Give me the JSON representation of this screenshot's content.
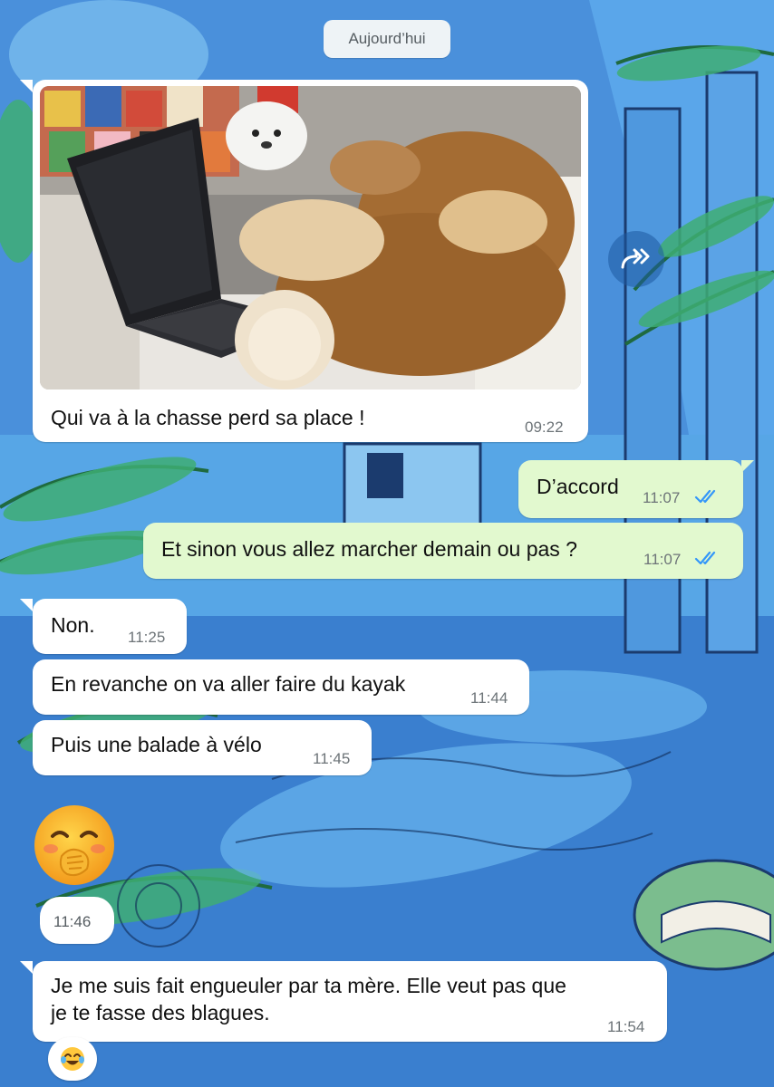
{
  "chat": {
    "date_label": "Aujourd’hui",
    "messages": [
      {
        "direction": "in",
        "type": "image",
        "caption": "Qui va à la chasse perd sa place !",
        "time": "09:22"
      },
      {
        "direction": "out",
        "text": "D’accord",
        "time": "11:07",
        "status": "read"
      },
      {
        "direction": "out",
        "text": "Et sinon vous allez marcher demain ou pas ?",
        "time": "11:07",
        "status": "read"
      },
      {
        "direction": "in",
        "text": "Non.",
        "time": "11:25"
      },
      {
        "direction": "in",
        "text": "En revanche on va aller faire du kayak",
        "time": "11:44"
      },
      {
        "direction": "in",
        "text": "Puis une balade à vélo",
        "time": "11:45"
      },
      {
        "direction": "in",
        "type": "emoji",
        "emoji": "🤭",
        "time": "11:46"
      },
      {
        "direction": "in",
        "text_line1": "Je me suis fait engueuler par ta mère. Elle veut pas que",
        "text_line2": "je te fasse des blagues.",
        "time": "11:54"
      }
    ],
    "reaction": "😂"
  },
  "icons": {
    "forward": "forward-double-arrow-icon",
    "read_receipt": "double-check-icon"
  },
  "colors": {
    "incoming_bubble": "#ffffff",
    "outgoing_bubble": "#e2f9cf",
    "read_tick": "#3497f9",
    "time_text": "#6d7478"
  }
}
